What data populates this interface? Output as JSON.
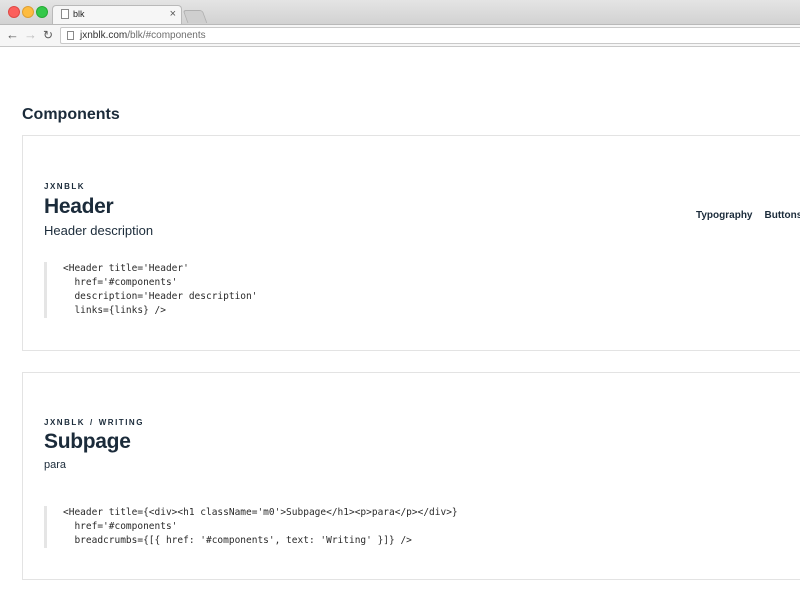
{
  "browser": {
    "tab_title": "blk",
    "tab_close": "×",
    "back_glyph": "←",
    "forward_glyph": "→",
    "reload_glyph": "↻",
    "url_host": "jxnblk.com",
    "url_path": "/blk/#components"
  },
  "page": {
    "title": "Components"
  },
  "cards": [
    {
      "eyebrow": "JXNBLK",
      "title": "Header",
      "description": "Header description",
      "links": [
        "Typography",
        "Buttons"
      ],
      "code": [
        "<Header title='Header'",
        "  href='#components'",
        "  description='Header description'",
        "  links={links} />"
      ]
    },
    {
      "eyebrow_parts": [
        "JXNBLK",
        "/",
        "WRITING"
      ],
      "title": "Subpage",
      "description": "para",
      "code": [
        "<Header title={<div><h1 className='m0'>Subpage</h1><p>para</p></div>}",
        "  href='#components'",
        "  breadcrumbs={[{ href: '#components', text: 'Writing' }]} />"
      ]
    }
  ]
}
